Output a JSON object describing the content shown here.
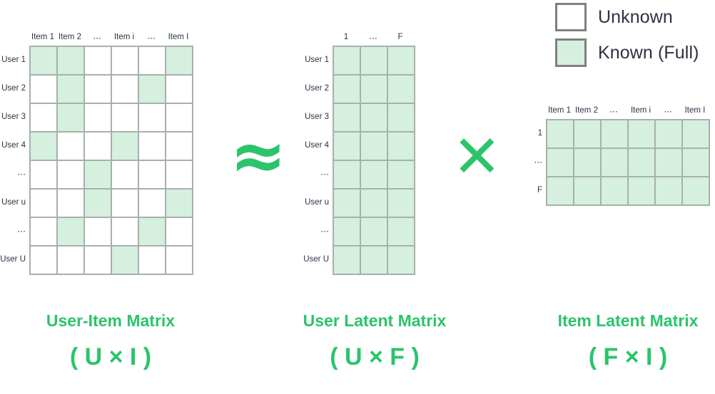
{
  "legend": {
    "items": [
      {
        "label": "Unknown",
        "swatch": "unknown",
        "color": "#ffffff"
      },
      {
        "label": "Known (Full)",
        "swatch": "known",
        "color": "#d5f0de"
      }
    ]
  },
  "colors": {
    "known_fill": "#d5f0de",
    "unknown_fill": "#ffffff",
    "cell_border": "#a8b0ab",
    "legend_border": "#808080",
    "accent_green": "#2bc46a",
    "label_text": "#2d3142"
  },
  "matrices": {
    "user_item": {
      "name": "User-Item Matrix",
      "dims_label": "( U × I )",
      "rows": 8,
      "cols": 6,
      "col_headers": [
        "Item 1",
        "Item 2",
        "⋯",
        "Item i",
        "⋯",
        "Item I"
      ],
      "row_labels": [
        "User 1",
        "User 2",
        "User 3",
        "User 4",
        "⋯",
        "User u",
        "⋯",
        "User U"
      ],
      "cells": [
        [
          1,
          1,
          0,
          0,
          0,
          1
        ],
        [
          0,
          1,
          0,
          0,
          1,
          0
        ],
        [
          0,
          1,
          0,
          0,
          0,
          0
        ],
        [
          1,
          0,
          0,
          1,
          0,
          0
        ],
        [
          0,
          0,
          1,
          0,
          0,
          0
        ],
        [
          0,
          0,
          1,
          0,
          0,
          1
        ],
        [
          0,
          1,
          0,
          0,
          1,
          0
        ],
        [
          0,
          0,
          0,
          1,
          0,
          0
        ]
      ]
    },
    "user_latent": {
      "name": "User Latent Matrix",
      "dims_label": "( U × F )",
      "rows": 8,
      "cols": 3,
      "col_headers": [
        "1",
        "⋯",
        "F"
      ],
      "row_labels": [
        "User 1",
        "User 2",
        "User 3",
        "User 4",
        "⋯",
        "User u",
        "⋯",
        "User U"
      ],
      "cells": [
        [
          1,
          1,
          1
        ],
        [
          1,
          1,
          1
        ],
        [
          1,
          1,
          1
        ],
        [
          1,
          1,
          1
        ],
        [
          1,
          1,
          1
        ],
        [
          1,
          1,
          1
        ],
        [
          1,
          1,
          1
        ],
        [
          1,
          1,
          1
        ]
      ]
    },
    "item_latent": {
      "name": "Item Latent Matrix",
      "dims_label": "( F × I )",
      "rows": 3,
      "cols": 6,
      "col_headers": [
        "Item 1",
        "Item 2",
        "⋯",
        "Item i",
        "⋯",
        "Item I"
      ],
      "row_labels": [
        "1",
        "⋯",
        "F"
      ],
      "cells": [
        [
          1,
          1,
          1,
          1,
          1,
          1
        ],
        [
          1,
          1,
          1,
          1,
          1,
          1
        ],
        [
          1,
          1,
          1,
          1,
          1,
          1
        ]
      ]
    }
  },
  "operators": {
    "approx": {
      "glyph": "≈",
      "meaning": "approximately-equal"
    },
    "times": {
      "glyph": "✕",
      "meaning": "matrix-multiplication"
    }
  }
}
